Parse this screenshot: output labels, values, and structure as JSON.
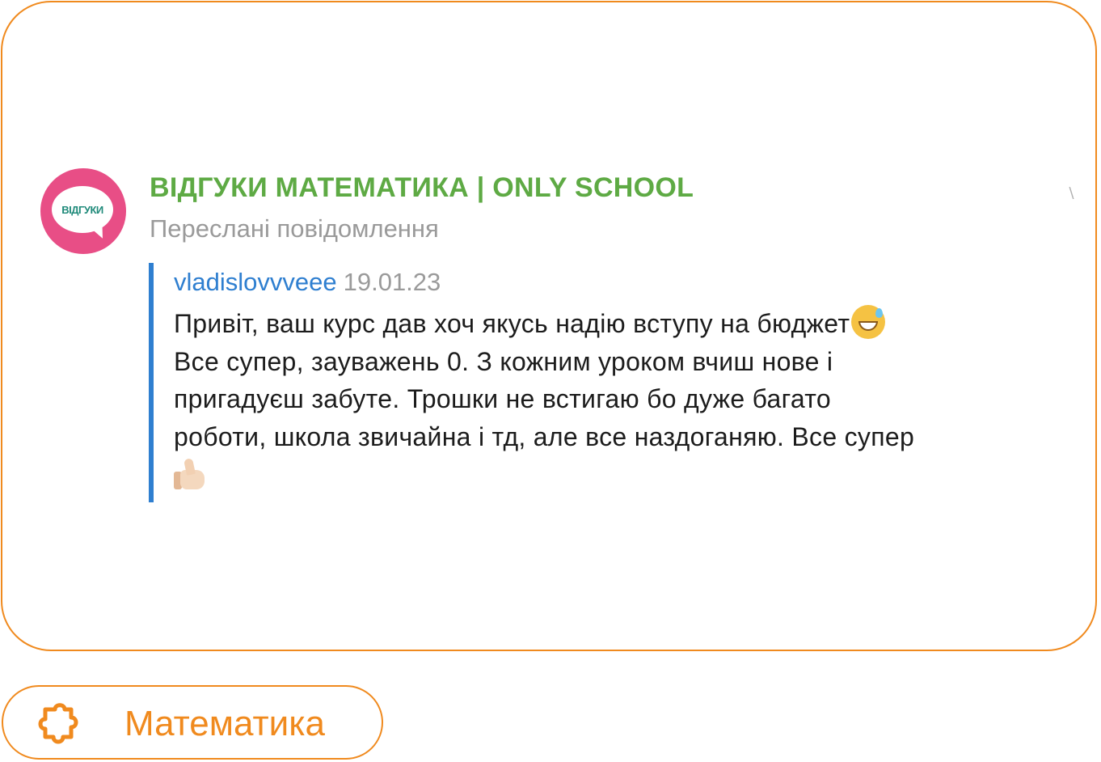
{
  "card": {
    "avatar_text": "ВІДГУКИ",
    "channel_title": "ВІДГУКИ МАТЕМАТИКА | ONLY SCHOOL",
    "forward_label": "Переслані повідомлення",
    "quote": {
      "author": "vladislovvveee",
      "date": "19.01.23",
      "lines": [
        "Привіт, ваш курс дав хоч якусь надію вступу на бюджет",
        "Все супер, зауважень 0. З кожним уроком вчиш нове і",
        "пригадуєш забуте. Трошки не встигаю бо дуже багато",
        "роботи, школа звичайна і тд, але все наздоганяю. Все супер"
      ],
      "emoji": [
        "grinning-sweat-emoji",
        "thumbs-up-emoji"
      ]
    }
  },
  "tag": {
    "icon": "puzzle-icon",
    "label": "Математика"
  },
  "colors": {
    "accent": "#f08a1e",
    "channel_green": "#5eaa44",
    "author_blue": "#2f7fd0",
    "avatar_pink": "#e84e86",
    "muted": "#9a9a9a"
  }
}
